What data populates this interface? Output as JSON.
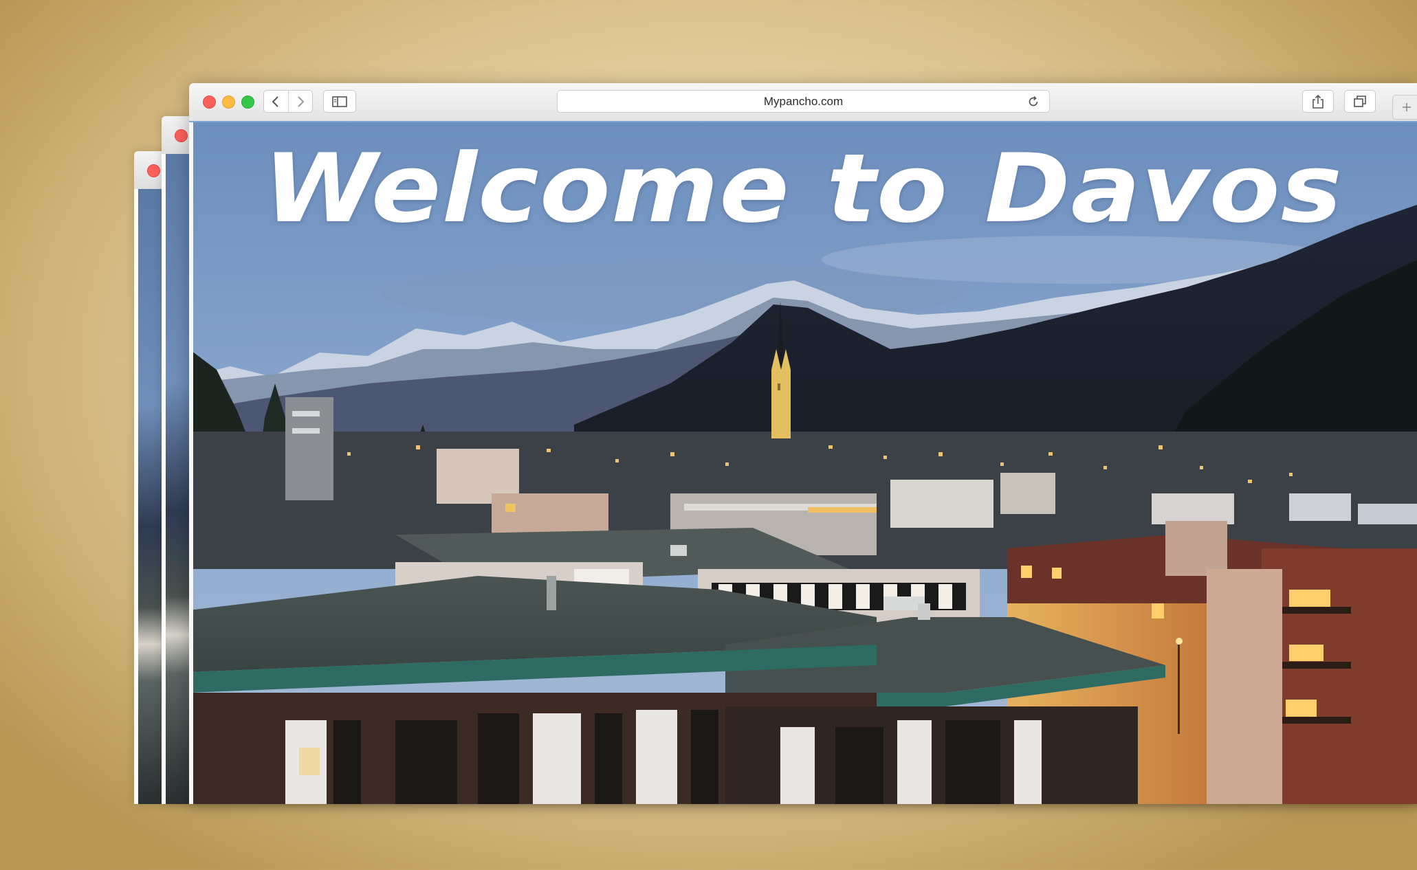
{
  "browser": {
    "address_url": "Mypancho.com",
    "icons": {
      "back": "chevron-left-icon",
      "forward": "chevron-right-icon",
      "sidebar": "sidebar-icon",
      "reload": "reload-icon",
      "share": "share-icon",
      "tabs": "tabs-overview-icon",
      "new_tab": "plus-icon"
    },
    "traffic_lights": {
      "close": "#fc605b",
      "minimize": "#fdbc40",
      "zoom": "#34c84a"
    }
  },
  "page": {
    "headline": "Welcome to Davos"
  },
  "colors": {
    "background": "#d9bf86",
    "accent_focus": "#7fa7d6"
  }
}
